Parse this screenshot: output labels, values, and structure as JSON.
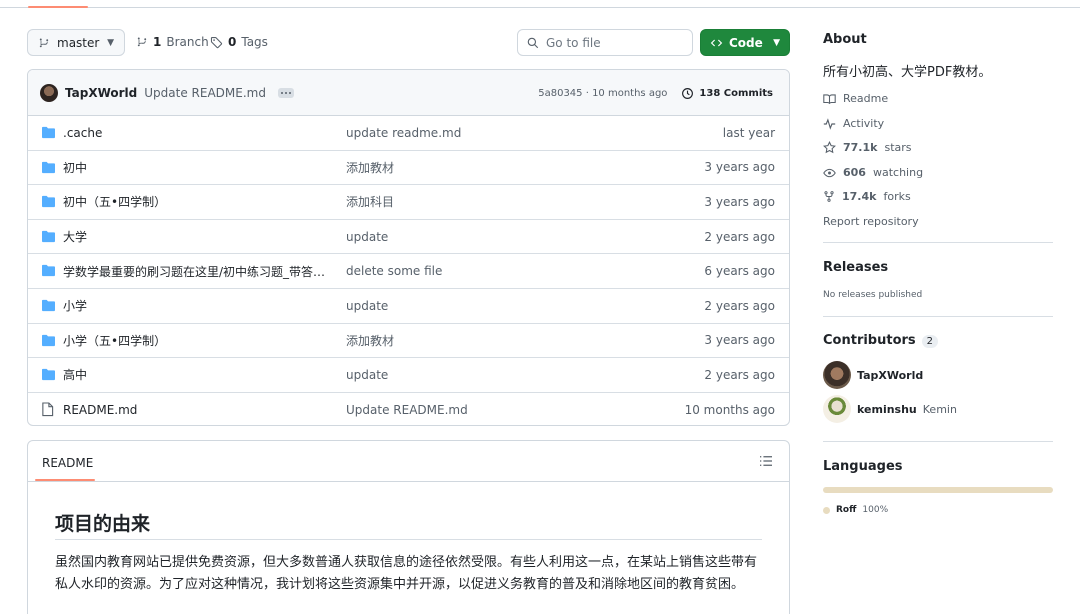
{
  "toolbar": {
    "branch": "master",
    "branches_count": "1",
    "branches_label": "Branch",
    "tags_count": "0",
    "tags_label": "Tags",
    "goto_placeholder": "Go to file",
    "code_label": "Code"
  },
  "latest_commit": {
    "author": "TapXWorld",
    "message": "Update README.md",
    "hash_time": "5a80345 · 10 months ago",
    "commits_label": "138 Commits"
  },
  "files": [
    {
      "type": "folder",
      "name": ".cache",
      "message": "update readme.md",
      "date": "last year"
    },
    {
      "type": "folder",
      "name": "初中",
      "message": "添加教材",
      "date": "3 years ago"
    },
    {
      "type": "folder",
      "name": "初中（五•四学制）",
      "message": "添加科目",
      "date": "3 years ago"
    },
    {
      "type": "folder",
      "name": "大学",
      "message": "update",
      "date": "2 years ago"
    },
    {
      "type": "folder",
      "name": "学数学最重要的刷习题在这里/初中练习题_带答…",
      "message": "delete some file",
      "date": "6 years ago"
    },
    {
      "type": "folder",
      "name": "小学",
      "message": "update",
      "date": "2 years ago"
    },
    {
      "type": "folder",
      "name": "小学（五•四学制）",
      "message": "添加教材",
      "date": "3 years ago"
    },
    {
      "type": "folder",
      "name": "高中",
      "message": "update",
      "date": "2 years ago"
    },
    {
      "type": "file",
      "name": "README.md",
      "message": "Update README.md",
      "date": "10 months ago"
    }
  ],
  "readme": {
    "tab_label": "README",
    "heading": "项目的由来",
    "paragraph": "虽然国内教育网站已提供免费资源，但大多数普通人获取信息的途径依然受限。有些人利用这一点，在某站上销售这些带有私人水印的资源。为了应对这种情况，我计划将这些资源集中并开源，以促进义务教育的普及和消除地区间的教育贫困。"
  },
  "about": {
    "title": "About",
    "description": "所有小初高、大学PDF教材。",
    "readme_label": "Readme",
    "activity_label": "Activity",
    "stars_count": "77.1k",
    "stars_label": "stars",
    "watching_count": "606",
    "watching_label": "watching",
    "forks_count": "17.4k",
    "forks_label": "forks",
    "report_label": "Report repository"
  },
  "releases": {
    "title": "Releases",
    "note": "No releases published"
  },
  "contributors": {
    "title": "Contributors",
    "count": "2",
    "people": [
      {
        "login": "TapXWorld",
        "name": ""
      },
      {
        "login": "keminshu",
        "name": "Kemin"
      }
    ]
  },
  "languages": {
    "title": "Languages",
    "items": [
      {
        "name": "Roff",
        "percent": "100%",
        "color": "#e8dcc0",
        "fraction": 1.0
      }
    ]
  }
}
